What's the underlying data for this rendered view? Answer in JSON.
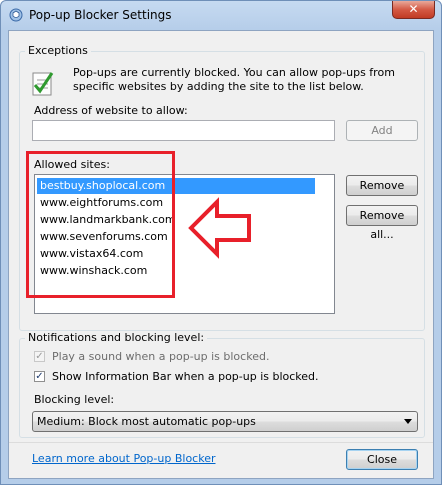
{
  "window": {
    "title": "Pop-up Blocker Settings",
    "close_glyph": "✕"
  },
  "exceptions": {
    "legend": "Exceptions",
    "info_text": "Pop-ups are currently blocked.  You can allow pop-ups from specific websites by adding the site to the list below.",
    "address_label": "Address of website to allow:",
    "address_value": "",
    "add_button": "Add",
    "allowed_label": "Allowed sites:",
    "sites": [
      "bestbuy.shoplocal.com",
      "www.eightforums.com",
      "www.landmarkbank.com",
      "www.sevenforums.com",
      "www.vistax64.com",
      "www.winshack.com"
    ],
    "selected_index": 0,
    "remove_button": "Remove",
    "remove_all_button": "Remove all..."
  },
  "notifications": {
    "legend": "Notifications and blocking level:",
    "play_sound_label": "Play a sound when a pop-up is blocked.",
    "play_sound_checked": true,
    "show_infobar_label": "Show Information Bar when a pop-up is blocked.",
    "show_infobar_checked": true,
    "blocking_level_label": "Blocking level:",
    "blocking_level_value": "Medium: Block most automatic pop-ups"
  },
  "footer": {
    "learn_more_link": "Learn more about Pop-up Blocker",
    "close_button": "Close"
  },
  "icons": {
    "title": "ie-shield-icon",
    "info": "checklist-icon"
  },
  "colors": {
    "annotation_red": "#e8202a",
    "selection_blue": "#3399ff",
    "link_blue": "#0066cc"
  },
  "check_glyph": "✓"
}
